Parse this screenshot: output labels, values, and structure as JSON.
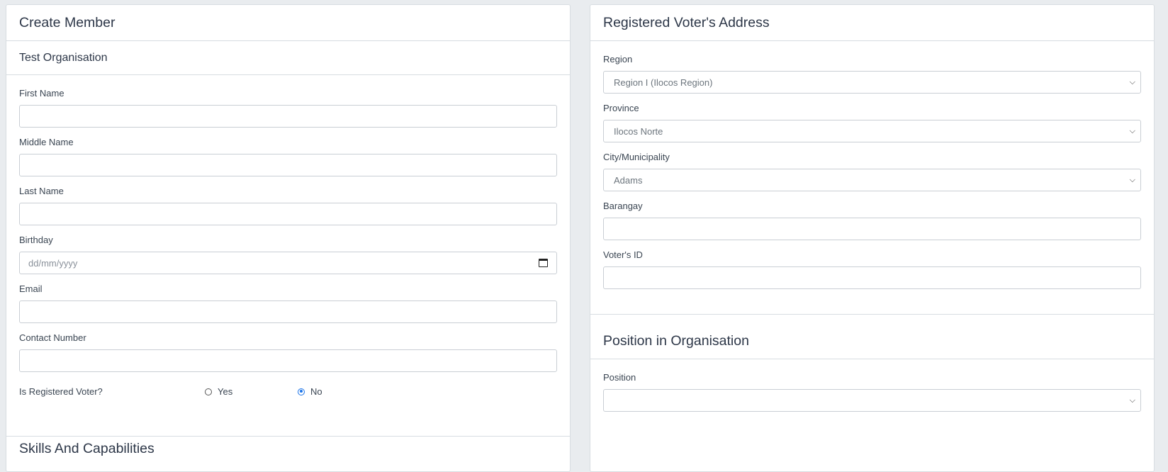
{
  "left": {
    "title": "Create Member",
    "organisation": "Test Organisation",
    "fields": [
      {
        "label": "First Name",
        "value": ""
      },
      {
        "label": "Middle Name",
        "value": ""
      },
      {
        "label": "Last Name",
        "value": ""
      },
      {
        "label": "Birthday",
        "placeholder": "dd/mm/yyyy"
      },
      {
        "label": "Email",
        "value": ""
      },
      {
        "label": "Contact Number",
        "value": ""
      }
    ],
    "registered_voter": {
      "question": "Is Registered Voter?",
      "yes_label": "Yes",
      "no_label": "No",
      "selected": "No"
    },
    "next_section_title": "Skills And Capabilities"
  },
  "right": {
    "title": "Registered Voter's Address",
    "region": {
      "label": "Region",
      "value": "Region I (Ilocos Region)"
    },
    "province": {
      "label": "Province",
      "value": "Ilocos Norte"
    },
    "city": {
      "label": "City/Municipality",
      "value": "Adams"
    },
    "barangay": {
      "label": "Barangay",
      "value": ""
    },
    "voter_id": {
      "label": "Voter's ID",
      "value": ""
    },
    "position_section": {
      "title": "Position in Organisation",
      "position_label": "Position",
      "position_value": ""
    }
  },
  "icons": {
    "select_arrow": "chevron-down-icon",
    "date_picker": "calendar-icon"
  },
  "colors": {
    "accent": "#1a73e8",
    "border": "#c9ced4",
    "background": "#e9ecef"
  }
}
